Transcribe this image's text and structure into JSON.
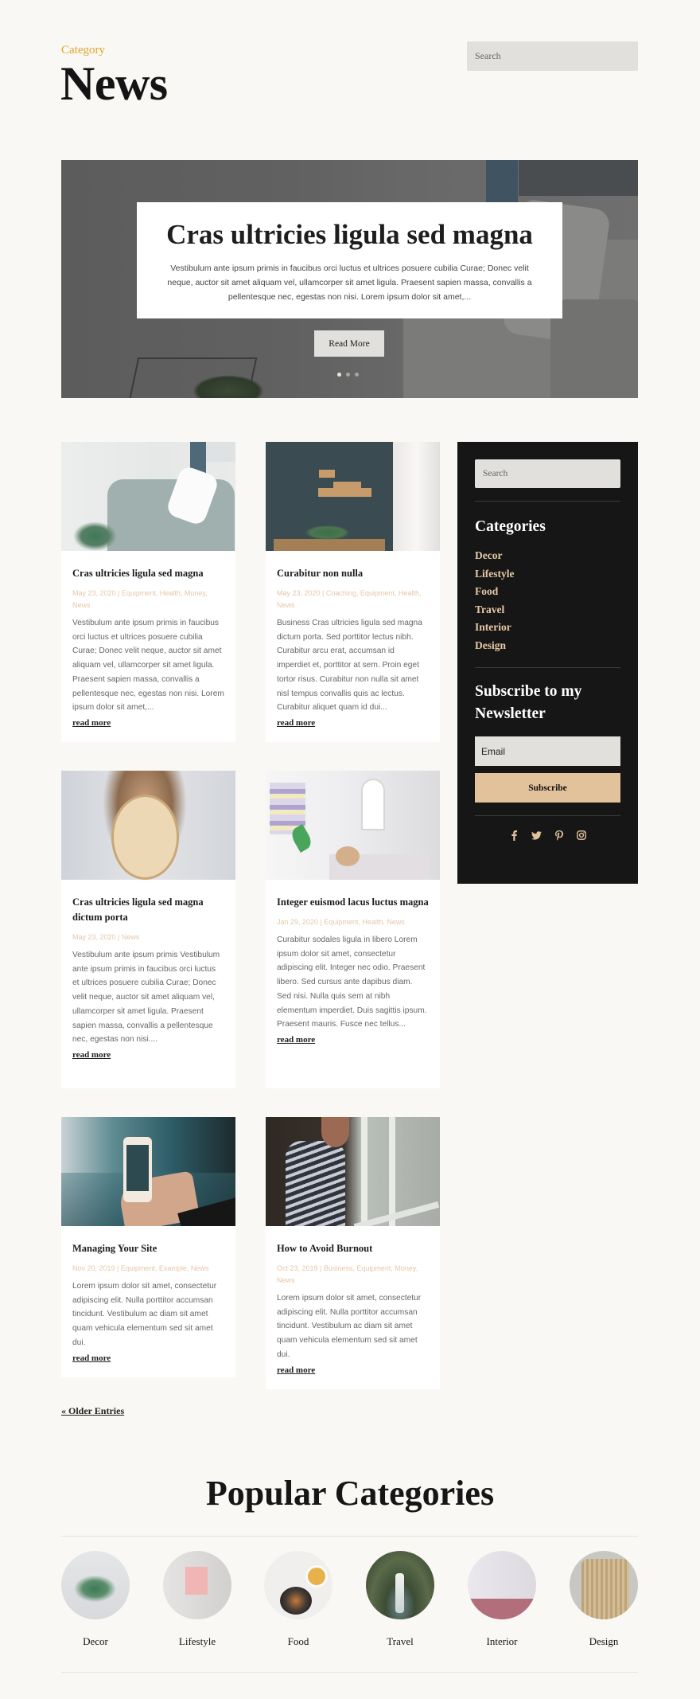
{
  "header": {
    "eyebrow": "Category",
    "title": "News",
    "search_placeholder": "Search"
  },
  "hero": {
    "title": "Cras ultricies ligula sed magna",
    "excerpt": "Vestibulum ante ipsum primis in faucibus orci luctus et ultrices posuere cubilia Curae; Donec velit neque, auctor sit amet aliquam vel, ullamcorper sit amet ligula. Praesent sapien massa, convallis a pellentesque nec, egestas non nisi. Lorem ipsum dolor sit amet,...",
    "button_label": "Read More",
    "slides_total": 3,
    "active_slide": 1
  },
  "posts": [
    {
      "title": "Cras ultricies ligula sed magna",
      "meta": "May 23, 2020 | Equipment, Health, Money, News",
      "excerpt": "Vestibulum ante ipsum primis in faucibus orci luctus et ultrices posuere cubilia Curae; Donec velit neque, auctor sit amet aliquam vel, ullamcorper sit amet ligula. Praesent sapien massa, convallis a pellentesque nec, egestas non nisi. Lorem ipsum dolor sit amet,...",
      "more": "read more"
    },
    {
      "title": "Curabitur non nulla",
      "meta": "May 23, 2020 | Coaching, Equipment, Health, News",
      "excerpt": "Business Cras ultricies ligula sed magna dictum porta. Sed porttitor lectus nibh. Curabitur arcu erat, accumsan id imperdiet et, porttitor at sem. Proin eget tortor risus. Curabitur non nulla sit amet nisl tempus convallis quis ac lectus. Curabitur aliquet quam id dui...",
      "more": "read more"
    },
    {
      "title": "Cras ultricies ligula sed magna dictum porta",
      "meta": "May 23, 2020 | News",
      "excerpt": "Vestibulum ante ipsum primis Vestibulum ante ipsum primis in faucibus orci luctus et ultrices posuere cubilia Curae; Donec velit neque, auctor sit amet aliquam vel, ullamcorper sit amet ligula. Praesent sapien massa, convallis a pellentesque nec, egestas non nisi....",
      "more": "read more"
    },
    {
      "title": "Integer euismod lacus luctus magna",
      "meta": "Jan 29, 2020 | Equipment, Health, News",
      "excerpt": "Curabitur sodales ligula in libero Lorem ipsum dolor sit amet, consectetur adipiscing elit. Integer nec odio. Praesent libero. Sed cursus ante dapibus diam. Sed nisi. Nulla quis sem at nibh elementum imperdiet. Duis sagittis ipsum. Praesent mauris. Fusce nec tellus...",
      "more": "read more"
    },
    {
      "title": "Managing Your Site",
      "meta": "Nov 20, 2019 | Equipment, Example, News",
      "excerpt": "Lorem ipsum dolor sit amet, consectetur adipiscing elit. Nulla porttitor accumsan tincidunt. Vestibulum ac diam sit amet quam vehicula elementum sed sit amet dui.",
      "more": "read more"
    },
    {
      "title": "How to Avoid Burnout",
      "meta": "Oct 23, 2019 | Business, Equipment, Money, News",
      "excerpt": "Lorem ipsum dolor sit amet, consectetur adipiscing elit. Nulla porttitor accumsan tincidunt. Vestibulum ac diam sit amet quam vehicula elementum sed sit amet dui.",
      "more": "read more"
    }
  ],
  "pagination": {
    "older": "« Older Entries"
  },
  "sidebar": {
    "search_placeholder": "Search",
    "categories_heading": "Categories",
    "categories": [
      "Decor",
      "Lifestyle",
      "Food",
      "Travel",
      "Interior",
      "Design"
    ],
    "newsletter_heading": "Subscribe to my Newsletter",
    "email_placeholder": "Email",
    "subscribe_label": "Subscribe",
    "socials": [
      "facebook-icon",
      "twitter-icon",
      "pinterest-icon",
      "instagram-icon"
    ]
  },
  "popular": {
    "heading": "Popular Categories",
    "items": [
      "Decor",
      "Lifestyle",
      "Food",
      "Travel",
      "Interior",
      "Design"
    ]
  },
  "colors": {
    "background": "#f9f8f4",
    "accent_gold": "#e0a52e",
    "accent_tan": "#e2c29b",
    "sidebar_bg": "#161616",
    "meta_text": "#e4c7a8"
  }
}
